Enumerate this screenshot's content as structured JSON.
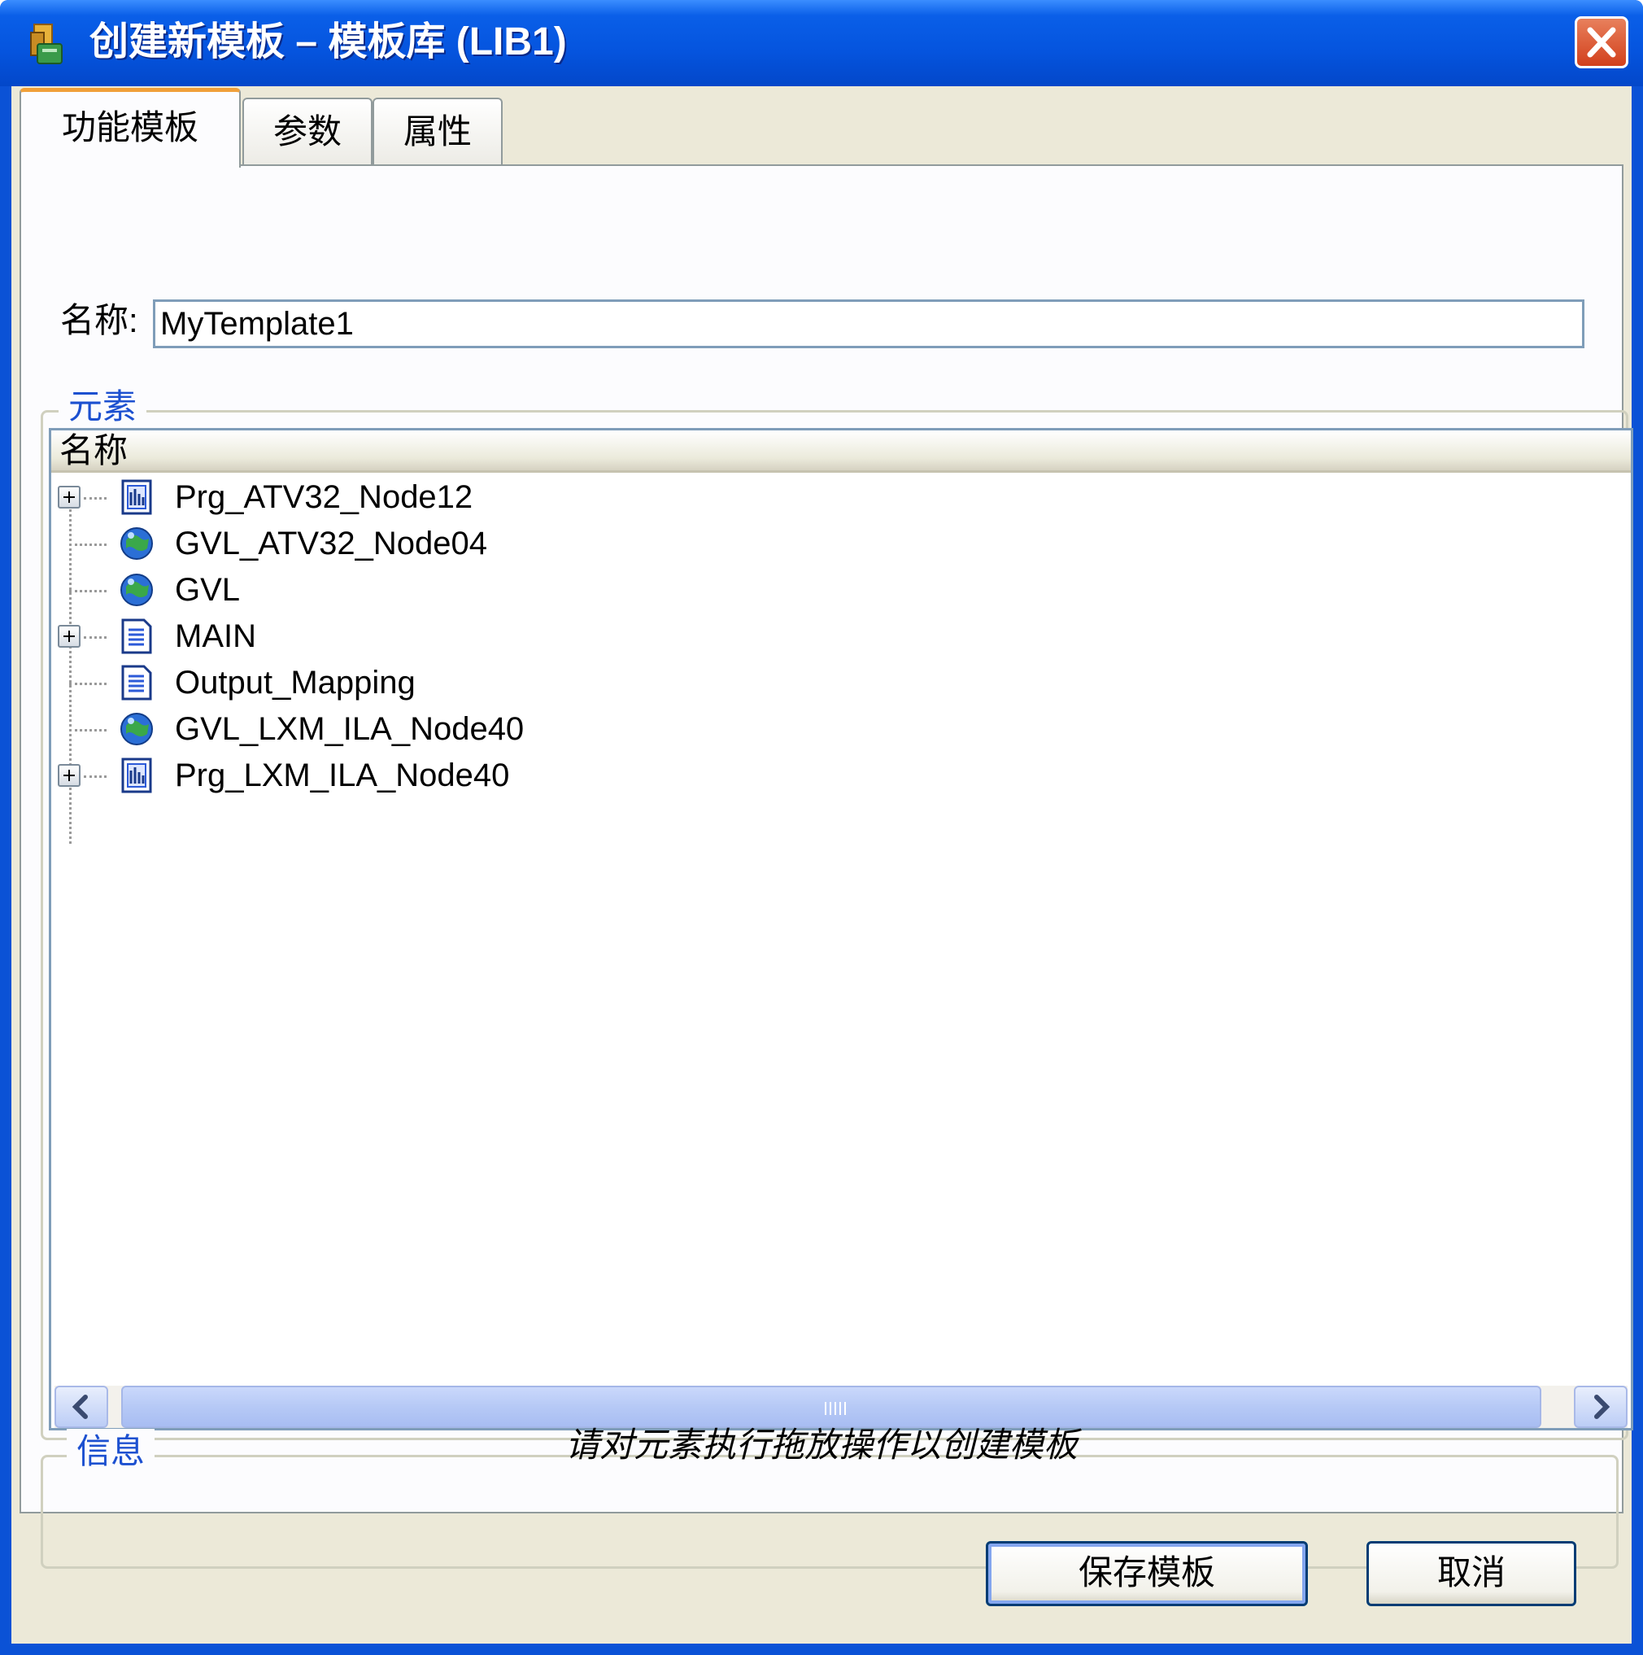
{
  "window": {
    "title": "创建新模板 – 模板库 (LIB1)"
  },
  "tabs": [
    {
      "label": "功能模板",
      "active": true
    },
    {
      "label": "参数",
      "active": false
    },
    {
      "label": "属性",
      "active": false
    }
  ],
  "name_field": {
    "label": "名称:",
    "value": "MyTemplate1"
  },
  "elements_group": {
    "title": "元素",
    "column_header": "名称",
    "items": [
      {
        "label": "Prg_ATV32_Node12",
        "icon": "program-icon",
        "expandable": true
      },
      {
        "label": "GVL_ATV32_Node04",
        "icon": "global-variables-icon",
        "expandable": false
      },
      {
        "label": "GVL",
        "icon": "global-variables-icon",
        "expandable": false
      },
      {
        "label": "MAIN",
        "icon": "document-icon",
        "expandable": true
      },
      {
        "label": "Output_Mapping",
        "icon": "document-icon",
        "expandable": false
      },
      {
        "label": "GVL_LXM_ILA_Node40",
        "icon": "global-variables-icon",
        "expandable": false
      },
      {
        "label": "Prg_LXM_ILA_Node40",
        "icon": "program-icon",
        "expandable": true
      }
    ]
  },
  "info_group": {
    "title": "信息",
    "message": "请对元素执行拖放操作以创建模板"
  },
  "buttons": {
    "save": "保存模板",
    "cancel": "取消"
  },
  "colors": {
    "titlebar": "#0554de",
    "dialog_bg": "#ece9d8",
    "group_title": "#1c50d0",
    "input_border": "#7f9db9"
  }
}
